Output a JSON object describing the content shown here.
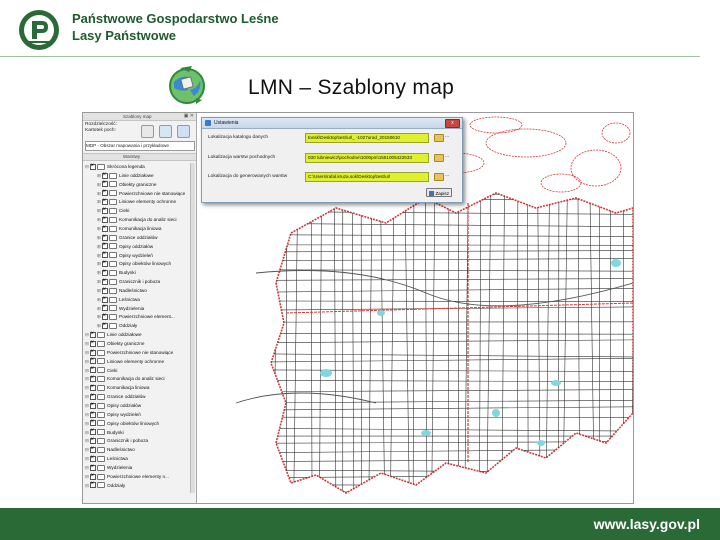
{
  "header": {
    "org_line1": "Państwowe Gospodarstwo Leśne",
    "org_line2": "Lasy Państwowe",
    "logo_text": "LASY PAŃSTWOWE",
    "slide_title": "LMN – Szablony map"
  },
  "app": {
    "panel_title": "Szablony map",
    "tpl_label1": "Rozdzielczość:",
    "tpl_label2": "Kartotek poch:",
    "template_select": "MDP - Obszar mapowania i przykładowe",
    "layers_panel_title": "Warstwy",
    "layers": [
      {
        "label": "Skrócona legenda",
        "checked": true,
        "expanded": true
      },
      {
        "label": "Linie oddziałowe",
        "checked": true,
        "expanded": false
      },
      {
        "label": "Obiekty graniczne",
        "checked": true,
        "expanded": false
      },
      {
        "label": "Powierzchniowe nie stanowiące",
        "checked": true,
        "expanded": false
      },
      {
        "label": "Liniowe elementy ochronne",
        "checked": true,
        "expanded": false
      },
      {
        "label": "Cieki",
        "checked": true,
        "expanded": false
      },
      {
        "label": "Komunikacja do analiz sieci",
        "checked": true,
        "expanded": false
      },
      {
        "label": "Komunikacja liniowa",
        "checked": true,
        "expanded": false
      },
      {
        "label": "Granice oddziałów",
        "checked": true,
        "expanded": false
      },
      {
        "label": "Opisy oddziałów",
        "checked": true,
        "expanded": false
      },
      {
        "label": "Opisy wydzieleń",
        "checked": true,
        "expanded": false
      },
      {
        "label": "Opisy obiektów liniowych",
        "checked": true,
        "expanded": false
      },
      {
        "label": "Budynki",
        "checked": true,
        "expanded": false
      },
      {
        "label": "Granicznik i poboza",
        "checked": true,
        "expanded": false
      },
      {
        "label": "Nadleśnictwo",
        "checked": true,
        "expanded": false
      },
      {
        "label": "Leśnictwa",
        "checked": true,
        "expanded": false
      },
      {
        "label": "Wydzielenia",
        "checked": true,
        "expanded": false
      },
      {
        "label": "Powierzchniowe element...",
        "checked": true,
        "expanded": false
      },
      {
        "label": "Oddziały",
        "checked": true,
        "expanded": false
      },
      {
        "label": "Linie oddziałowe",
        "checked": true,
        "expanded": true
      },
      {
        "label": "Obiekty graniczne",
        "checked": true,
        "expanded": true
      },
      {
        "label": "Powierzchniowe nie stanowiące",
        "checked": true,
        "expanded": true
      },
      {
        "label": "Liniowe elementy ochronne",
        "checked": true,
        "expanded": true
      },
      {
        "label": "Cieki",
        "checked": true,
        "expanded": true
      },
      {
        "label": "Komunikacja do analiz sieci",
        "checked": true,
        "expanded": true
      },
      {
        "label": "Komunikacja liniowa",
        "checked": true,
        "expanded": true
      },
      {
        "label": "Granice oddziałów",
        "checked": true,
        "expanded": true
      },
      {
        "label": "Opisy oddziałów",
        "checked": true,
        "expanded": true
      },
      {
        "label": "Opisy wydzieleń",
        "checked": true,
        "expanded": true
      },
      {
        "label": "Opisy obiektów liniowych",
        "checked": true,
        "expanded": true
      },
      {
        "label": "Budynki",
        "checked": true,
        "expanded": true
      },
      {
        "label": "Granicznik i poboza",
        "checked": true,
        "expanded": true
      },
      {
        "label": "Nadleśnictwo",
        "checked": true,
        "expanded": true
      },
      {
        "label": "Leśnictwa",
        "checked": true,
        "expanded": true
      },
      {
        "label": "Wydzielenia",
        "checked": true,
        "expanded": true
      },
      {
        "label": "Powierzchniowe elementy n...",
        "checked": true,
        "expanded": true
      },
      {
        "label": "Oddziały",
        "checked": true,
        "expanded": true
      }
    ]
  },
  "dialog": {
    "title": "Ustawienia",
    "close_label": "x",
    "rows": [
      {
        "label": "Lokalizacja katalogu danych",
        "value": "tonsk\\Desktop\\test\\url_ -1027urad_20150610"
      },
      {
        "label": "Lokalizacja warstw pochodnych",
        "value": "030 lubniewicz\\pochodne\\1000pm\\1551005422533"
      },
      {
        "label": "Lokalizacja do generowanych warstw",
        "value": "C:\\Users\\rafal.kruza.sok\\Desktop\\test\\url"
      }
    ],
    "browse_label": "...",
    "save_label": "Zapisz"
  },
  "colors": {
    "brand_green": "#1e5b2f",
    "footer_green": "#2a6a36",
    "field_yellow": "#dff02e",
    "map_red": "#d23a3a"
  },
  "footer": {
    "url": "www.lasy.gov.pl"
  }
}
